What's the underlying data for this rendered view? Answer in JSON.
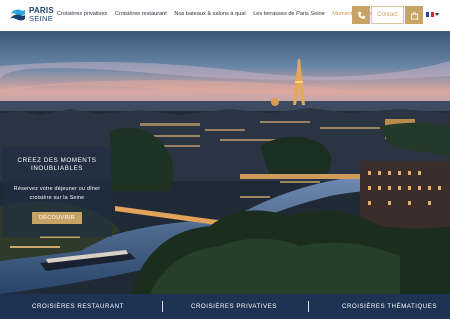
{
  "brand": {
    "name": "PARIS",
    "sub": "SEINE",
    "colors": {
      "navy": "#1c3f72",
      "gold": "#c8a366",
      "bar": "#1e3253"
    }
  },
  "nav": {
    "items": [
      "Croisières privatives",
      "Croisières restaurant",
      "Nos bateaux & salons à quai",
      "Les terrasses de Paris Seine"
    ],
    "active": "Moments sur Seine"
  },
  "actions": {
    "phone_icon": "phone-icon",
    "contact_label": "Contact",
    "cart_icon": "bag-icon",
    "language": "FR"
  },
  "promo": {
    "title": "CREEZ DES MOMENTS INOUBLIABLES",
    "text": "Réservez votre déjeuner ou dîner croisière sur la Seine",
    "button": "DÉCOUVRIR"
  },
  "bottom_bar": {
    "items": [
      "CROISIÈRES RESTAURANT",
      "CROISIÈRES PRIVATIVES",
      "CROISIÈRES THÉMATIQUES"
    ]
  }
}
